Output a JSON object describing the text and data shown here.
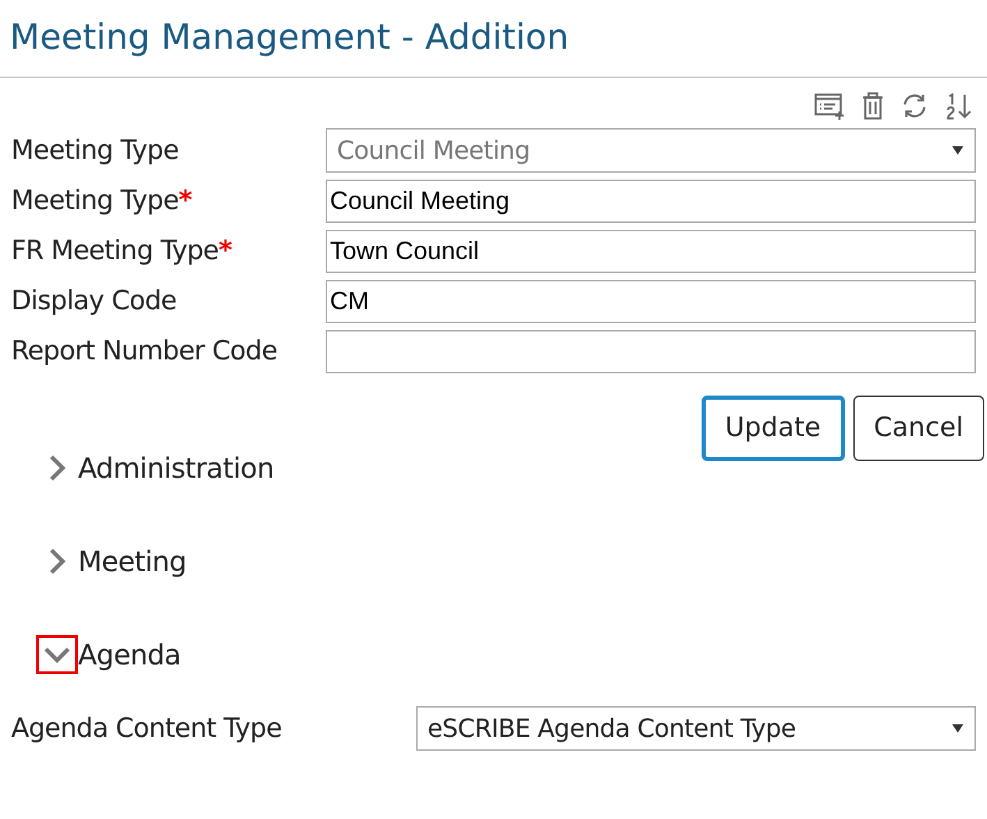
{
  "title": "Meeting Management - Addition",
  "toolbar": [
    {
      "kind": "add-list"
    },
    {
      "kind": "delete"
    },
    {
      "kind": "refresh"
    },
    {
      "kind": "sort"
    }
  ],
  "fields": [
    {
      "kind": "select",
      "label": "Meeting Type",
      "required": false,
      "value": "Council Meeting",
      "disabled": true
    },
    {
      "kind": "text",
      "label": "Meeting Type",
      "required": true,
      "value": "Council Meeting"
    },
    {
      "kind": "text",
      "label": "FR Meeting Type",
      "required": true,
      "value": "Town Council"
    },
    {
      "kind": "text",
      "label": "Display Code",
      "required": false,
      "value": "CM"
    },
    {
      "kind": "text",
      "label": "Report Number Code",
      "required": false
    }
  ],
  "required_mark": "*",
  "buttons": [
    {
      "label": "Update",
      "focused": true
    },
    {
      "label": "Cancel",
      "focused": false
    }
  ],
  "sections": [
    {
      "label": "Administration",
      "expanded": false,
      "highlighted": false
    },
    {
      "label": "Meeting",
      "expanded": false,
      "highlighted": false
    },
    {
      "label": "Agenda",
      "expanded": true,
      "highlighted": true
    }
  ],
  "agenda_fields": [
    {
      "kind": "select",
      "label": "Agenda Content Type",
      "required": false,
      "value": "eSCRIBE Agenda Content Type",
      "disabled": false
    }
  ]
}
